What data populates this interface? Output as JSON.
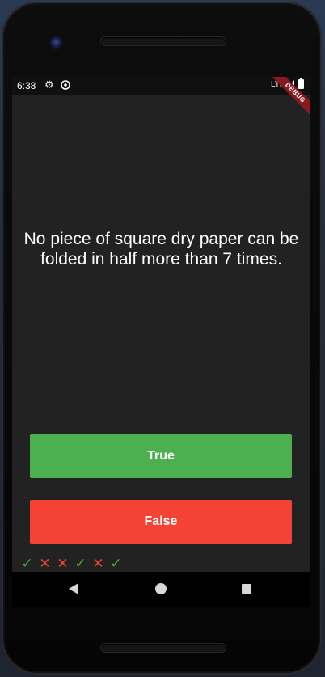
{
  "status_bar": {
    "time": "6:38",
    "network": "LTE",
    "icons": [
      "gear-icon",
      "sync-icon",
      "signal-icon",
      "battery-icon"
    ]
  },
  "debug_banner": "DEBUG",
  "question": {
    "text": "No piece of square dry paper can be folded in half more than 7 times."
  },
  "buttons": {
    "true_label": "True",
    "false_label": "False"
  },
  "colors": {
    "true_button": "#4caf50",
    "false_button": "#f44336",
    "correct_mark": "#4caf50",
    "wrong_mark": "#f44336",
    "background": "#222222"
  },
  "score_marks": [
    {
      "type": "check",
      "symbol": "✓"
    },
    {
      "type": "cross",
      "symbol": "✕"
    },
    {
      "type": "cross",
      "symbol": "✕"
    },
    {
      "type": "check",
      "symbol": "✓"
    },
    {
      "type": "cross",
      "symbol": "✕"
    },
    {
      "type": "check",
      "symbol": "✓"
    }
  ],
  "nav_bar": {
    "icons": [
      "back-icon",
      "home-icon",
      "recents-icon"
    ]
  }
}
